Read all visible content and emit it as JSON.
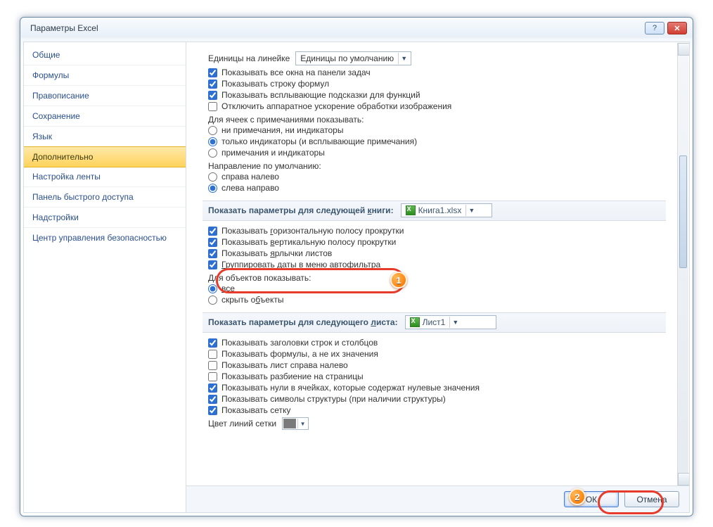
{
  "title": "Параметры Excel",
  "sidebar": {
    "items": [
      "Общие",
      "Формулы",
      "Правописание",
      "Сохранение",
      "Язык",
      "Дополнительно",
      "Настройка ленты",
      "Панель быстрого доступа",
      "Надстройки",
      "Центр управления безопасностью"
    ],
    "selected_index": 5
  },
  "ruler_row": {
    "label": "Единицы на линейке",
    "combo": "Единицы по умолчанию"
  },
  "display_checks": [
    {
      "label": "Показывать все окна на панели задач",
      "checked": true
    },
    {
      "label": "Показывать строку формул",
      "checked": true
    },
    {
      "label": "Показывать всплывающие подсказки для функций",
      "checked": true
    },
    {
      "label": "Отключить аппаратное ускорение обработки изображения",
      "checked": false
    }
  ],
  "comments": {
    "title": "Для ячеек с примечаниями показывать:",
    "options": [
      {
        "label": "ни примечания, ни индикаторы",
        "selected": false
      },
      {
        "label": "только индикаторы (и всплывающие примечания)",
        "selected": true
      },
      {
        "label": "примечания и индикаторы",
        "selected": false
      }
    ]
  },
  "direction": {
    "title": "Направление по умолчанию:",
    "options": [
      {
        "label": "справа налево",
        "selected": false
      },
      {
        "label": "слева направо",
        "selected": true
      }
    ]
  },
  "book_section": {
    "head_pre": "Показать параметры для следующей ",
    "head_u": "к",
    "head_post": "ниги:",
    "combo": "Книга1.xlsx",
    "checks": [
      {
        "pre": "Показывать ",
        "u": "г",
        "post": "оризонтальную полосу прокрутки",
        "checked": true
      },
      {
        "pre": "Показывать ",
        "u": "в",
        "post": "ертикальную полосу прокрутки",
        "checked": true
      },
      {
        "pre": "Показывать ",
        "u": "я",
        "post": "рлычки листов",
        "checked": true
      },
      {
        "pre": "",
        "u": "Г",
        "post": "руппировать даты в меню автофильтра",
        "checked": true
      }
    ],
    "objects": {
      "title": "Для объектов показывать:",
      "options": [
        {
          "u": "в",
          "post": "се",
          "selected": true
        },
        {
          "pre": "скрыть о",
          "u": "б",
          "post": "ъекты",
          "selected": false
        }
      ]
    }
  },
  "sheet_section": {
    "head_pre": "Показать параметры для следующего ",
    "head_u": "л",
    "head_post": "иста:",
    "combo": "Лист1",
    "checks": [
      {
        "label": "Показывать заголовки строк и столбцов",
        "checked": true
      },
      {
        "label": "Показывать формулы, а не их значения",
        "checked": false
      },
      {
        "label": "Показывать лист справа налево",
        "checked": false
      },
      {
        "label": "Показывать разбиение на страницы",
        "checked": false
      },
      {
        "label": "Показывать нули в ячейках, которые содержат нулевые значения",
        "checked": true
      },
      {
        "label": "Показывать символы структуры (при наличии структуры)",
        "checked": true
      },
      {
        "label": "Показывать сетку",
        "checked": true
      }
    ],
    "gridline": {
      "label": "Цвет линий сетки"
    }
  },
  "buttons": {
    "ok": "ОК",
    "cancel": "Отмена"
  },
  "annotations": {
    "badge1": "1",
    "badge2": "2"
  }
}
